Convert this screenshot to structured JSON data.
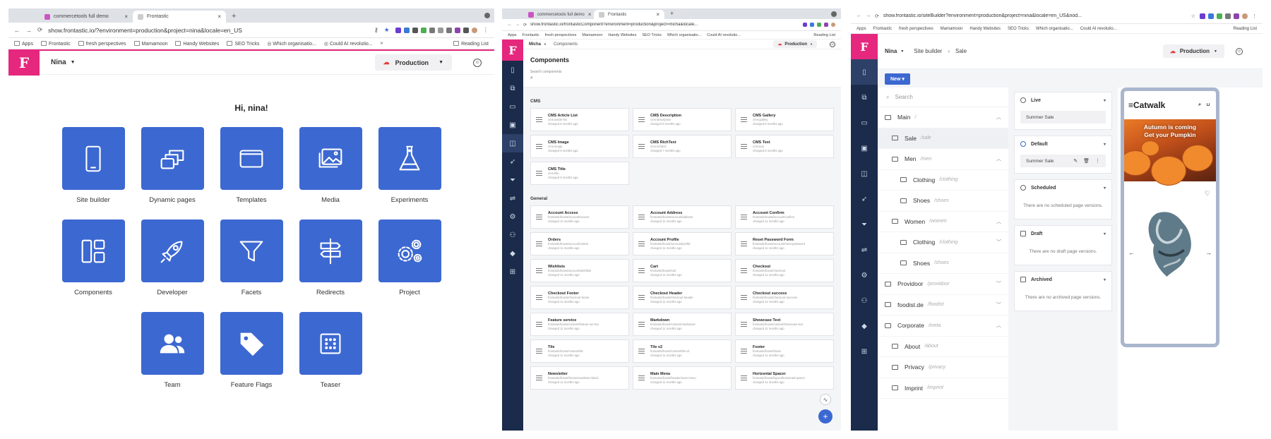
{
  "browser": {
    "tab1": "commercetools full demo",
    "tab2": "Frontastic",
    "bookmarks": [
      "Apps",
      "Frontastic",
      "fresh perspectives",
      "Mamamoon",
      "Handy Websites",
      "SEO Tricks",
      "Which organisatio...",
      "Could AI revolutio..."
    ],
    "reading_list": "Reading List"
  },
  "panel1": {
    "url": "show.frontastic.io/?environment=production&project=nina&locale=en_US",
    "project": "Nina",
    "environment": "Production",
    "greeting": "Hi, nina!",
    "tiles": [
      {
        "label": "Site builder",
        "icon": "mobile-icon"
      },
      {
        "label": "Dynamic pages",
        "icon": "stacked-pages-icon"
      },
      {
        "label": "Templates",
        "icon": "window-icon"
      },
      {
        "label": "Media",
        "icon": "images-icon"
      },
      {
        "label": "Experiments",
        "icon": "flask-icon"
      },
      {
        "label": "Components",
        "icon": "layout-icon"
      },
      {
        "label": "Developer",
        "icon": "rocket-icon"
      },
      {
        "label": "Facets",
        "icon": "funnel-icon"
      },
      {
        "label": "Redirects",
        "icon": "signpost-icon"
      },
      {
        "label": "Project",
        "icon": "gears-icon"
      },
      {
        "label": "Team",
        "icon": "team-icon"
      },
      {
        "label": "Feature Flags",
        "icon": "tag-icon"
      },
      {
        "label": "Teaser",
        "icon": "teaser-icon"
      }
    ]
  },
  "panel2": {
    "url": "show.frontastic.io/frontasticComponent?environment=production&project=micha&locale...",
    "project": "Micha",
    "breadcrumb": "Components",
    "environment": "Production",
    "title": "Components",
    "search_label": "Search components",
    "sections": [
      {
        "name": "CMS",
        "items": [
          {
            "title": "CMS Article List",
            "sub1": "cms-article-list",
            "sub2": "changed 8 months ago"
          },
          {
            "title": "CMS Description",
            "sub1": "cms-description",
            "sub2": "changed 8 months ago"
          },
          {
            "title": "CMS Gallery",
            "sub1": "cms-gallery",
            "sub2": "changed 8 months ago"
          },
          {
            "title": "CMS Image",
            "sub1": "cms-image",
            "sub2": "changed 8 months ago"
          },
          {
            "title": "CMS RichText",
            "sub1": "cms-richtext",
            "sub2": "changed 7 months ago"
          },
          {
            "title": "CMS Text",
            "sub1": "cms-text",
            "sub2": "changed 8 months ago"
          },
          {
            "title": "CMS Title",
            "sub1": "cms-title",
            "sub2": "changed 8 months ago"
          }
        ]
      },
      {
        "name": "General",
        "items": [
          {
            "title": "Account Access",
            "sub1": "frontastic/boost/account/access",
            "sub2": "changed 11 months ago"
          },
          {
            "title": "Account Address",
            "sub1": "frontastic/boost/account/address",
            "sub2": "changed 11 months ago"
          },
          {
            "title": "Account Confirm",
            "sub1": "frontastic/boost/account/confirm",
            "sub2": "changed 11 months ago"
          },
          {
            "title": "Orders",
            "sub1": "frontastic/boost/account/orders",
            "sub2": "changed 11 months ago"
          },
          {
            "title": "Account Profile",
            "sub1": "frontastic/boost/account/profile",
            "sub2": "changed 11 months ago"
          },
          {
            "title": "Reset Password Form",
            "sub1": "frontastic/boost/account/reset-password",
            "sub2": "changed 11 months ago"
          },
          {
            "title": "Wishlists",
            "sub1": "frontastic/boost/account/wishlists",
            "sub2": "changed 11 months ago"
          },
          {
            "title": "Cart",
            "sub1": "frontastic/boost/cart",
            "sub2": "changed 11 months ago"
          },
          {
            "title": "Checkout",
            "sub1": "frontastic/boost/checkout",
            "sub2": "changed 11 months ago"
          },
          {
            "title": "Checkout Footer",
            "sub1": "frontastic/boost/checkout-footer",
            "sub2": "changed 11 months ago"
          },
          {
            "title": "Checkout Header",
            "sub1": "frontastic/boost/checkout-header",
            "sub2": "changed 11 months ago"
          },
          {
            "title": "Checkout success",
            "sub1": "frontastic/boost/checkout-success",
            "sub2": "changed 11 months ago"
          },
          {
            "title": "Feature service",
            "sub1": "frontastic/boost/content/feature-service",
            "sub2": "changed 11 months ago"
          },
          {
            "title": "Markdown",
            "sub1": "frontastic/boost/content/markdown",
            "sub2": "changed 11 months ago"
          },
          {
            "title": "Showcase Text",
            "sub1": "frontastic/boost/content/showcase-text",
            "sub2": "changed 11 months ago"
          },
          {
            "title": "Tile",
            "sub1": "frontastic/boost/content/tile",
            "sub2": "changed 11 months ago"
          },
          {
            "title": "Tile v2",
            "sub1": "frontastic/boost/content/tile-v2",
            "sub2": "changed 11 months ago"
          },
          {
            "title": "Footer",
            "sub1": "frontastic/boost/footer",
            "sub2": "changed 11 months ago"
          },
          {
            "title": "Newsletter",
            "sub1": "frontastic/boost/forms/newsletter-block",
            "sub2": "changed 11 months ago"
          },
          {
            "title": "Main Menu",
            "sub1": "frontastic/boost/header/main-menu",
            "sub2": "changed 11 months ago"
          },
          {
            "title": "Horizontal Spacer",
            "sub1": "frontastic/boost/layout/horizontal-spacer",
            "sub2": "changed 11 months ago"
          }
        ]
      }
    ]
  },
  "panel3": {
    "url": "show.frontastic.io/siteBuilder?environment=production&project=nina&locale=en_US&nod...",
    "project": "Nina",
    "breadcrumb1": "Site builder",
    "breadcrumb2": "Sale",
    "environment": "Production",
    "new_button": "New",
    "search_placeholder": "Search",
    "tree": [
      {
        "name": "Main",
        "path": "/",
        "level": 0,
        "caret": "^"
      },
      {
        "name": "Sale",
        "path": "/sale",
        "level": 1,
        "caret": "",
        "selected": true
      },
      {
        "name": "Men",
        "path": "/men",
        "level": 1,
        "caret": "^"
      },
      {
        "name": "Clothing",
        "path": "/clothing",
        "level": 2,
        "caret": ""
      },
      {
        "name": "Shoes",
        "path": "/shoes",
        "level": 2,
        "caret": ""
      },
      {
        "name": "Women",
        "path": "/women",
        "level": 1,
        "caret": "^"
      },
      {
        "name": "Clothing",
        "path": "/clothing",
        "level": 2,
        "caret": "v"
      },
      {
        "name": "Shoes",
        "path": "/shoes",
        "level": 2,
        "caret": ""
      },
      {
        "name": "Providoor",
        "path": "/providoor",
        "level": 0,
        "caret": "v"
      },
      {
        "name": "foodist.de",
        "path": "/foodist",
        "level": 0,
        "caret": "v"
      },
      {
        "name": "Corporate",
        "path": "/meta",
        "level": 0,
        "caret": "^"
      },
      {
        "name": "About",
        "path": "/about",
        "level": 1,
        "caret": ""
      },
      {
        "name": "Privacy",
        "path": "/privacy",
        "level": 1,
        "caret": ""
      },
      {
        "name": "Imprint",
        "path": "/imprint",
        "level": 1,
        "caret": ""
      }
    ],
    "versions": {
      "live": {
        "label": "Live",
        "item": "Summer Sale"
      },
      "default": {
        "label": "Default",
        "item": "Summer Sale"
      },
      "scheduled": {
        "label": "Scheduled",
        "empty": "There are no scheduled page versions."
      },
      "draft": {
        "label": "Draft",
        "empty": "There are no draft page versions."
      },
      "archived": {
        "label": "Archived",
        "empty": "There are no archived page versions."
      }
    },
    "preview": {
      "brand": "≡Catwalk",
      "hero_line1": "Autumn is coming",
      "hero_line2": "Get your Pumpkin"
    }
  },
  "colors": {
    "brand_pink": "#e5277d",
    "tile_blue": "#3c68d1",
    "nav_dark": "#1a2b4b",
    "cloud_red": "#e53e3e"
  }
}
